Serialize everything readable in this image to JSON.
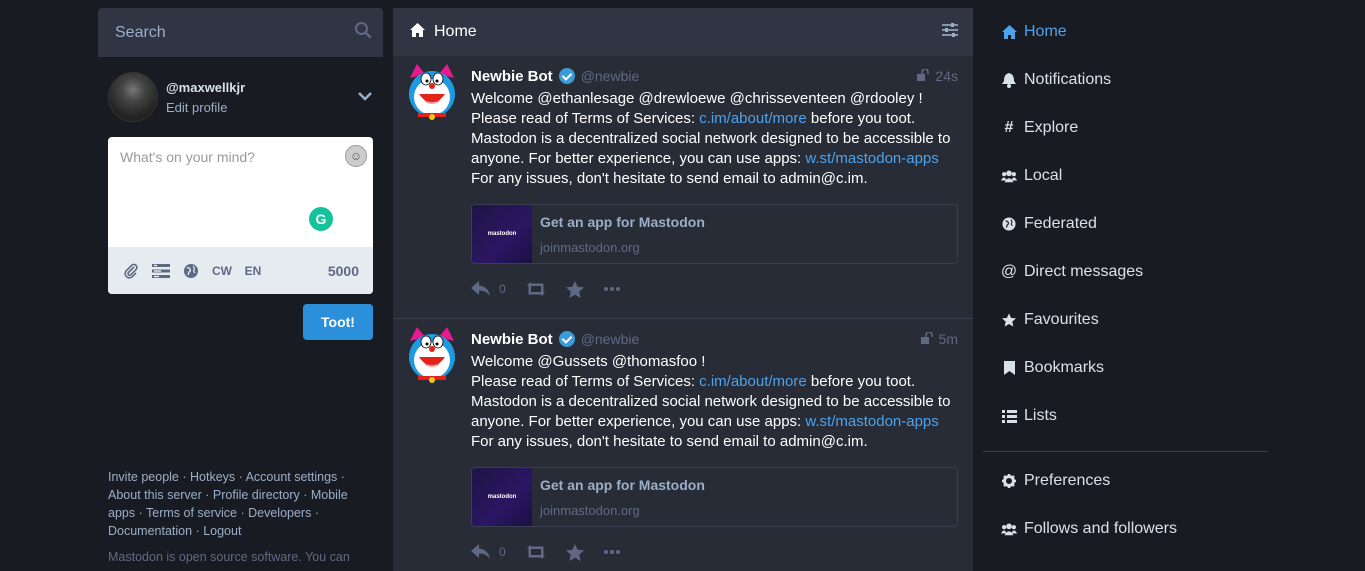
{
  "search": {
    "placeholder": "Search"
  },
  "profile": {
    "handle": "@maxwellkjr",
    "edit_label": "Edit profile"
  },
  "compose": {
    "placeholder": "What's on your mind?",
    "cw_label": "CW",
    "lang_label": "EN",
    "char_count": "5000",
    "toot_label": "Toot!"
  },
  "footer": {
    "invite": "Invite people",
    "hotkeys": "Hotkeys",
    "account_settings": "Account settings",
    "about": "About this server",
    "directory": "Profile directory",
    "mobile_apps": "Mobile apps",
    "terms": "Terms of service",
    "developers": "Developers",
    "documentation": "Documentation",
    "logout": "Logout",
    "note": "Mastodon is open source software. You can"
  },
  "column": {
    "title": "Home"
  },
  "statuses": [
    {
      "display_name": "Newbie Bot",
      "acct": "@newbie",
      "time": "24s",
      "line1": "Welcome @ethanlesage @drewloewe @chrisseventeen @rdooley !",
      "line2_pre": "Please read of Terms of Services: ",
      "line2_link": "c.im/about/more",
      "line2_post": " before you toot.",
      "line3": "Mastodon is a decentralized social network designed to be accessible to",
      "line4_pre": "anyone. For better experience, you can use apps: ",
      "line4_link": "w.st/mastodon-apps",
      "line5": "For any issues, don't hesitate to send email to admin@c.im.",
      "card_thumb_text": "mastodon",
      "card_title": "Get an app for Mastodon",
      "card_host": "joinmastodon.org",
      "reply_count": "0"
    },
    {
      "display_name": "Newbie Bot",
      "acct": "@newbie",
      "time": "5m",
      "line1": "Welcome @Gussets @thomasfoo !",
      "line2_pre": "Please read of Terms of Services: ",
      "line2_link": "c.im/about/more",
      "line2_post": " before you toot.",
      "line3": "Mastodon is a decentralized social network designed to be accessible to",
      "line4_pre": "anyone. For better experience, you can use apps: ",
      "line4_link": "w.st/mastodon-apps",
      "line5": "For any issues, don't hesitate to send email to admin@c.im.",
      "card_thumb_text": "mastodon",
      "card_title": "Get an app for Mastodon",
      "card_host": "joinmastodon.org",
      "reply_count": "0"
    }
  ],
  "nav": {
    "home": "Home",
    "notifications": "Notifications",
    "explore": "Explore",
    "local": "Local",
    "federated": "Federated",
    "direct": "Direct messages",
    "favourites": "Favourites",
    "bookmarks": "Bookmarks",
    "lists": "Lists",
    "preferences": "Preferences",
    "follows": "Follows and followers"
  },
  "colors": {
    "accent": "#2b90d9",
    "link": "#4ea2ea",
    "background": "#191b22",
    "column": "#282c37"
  }
}
